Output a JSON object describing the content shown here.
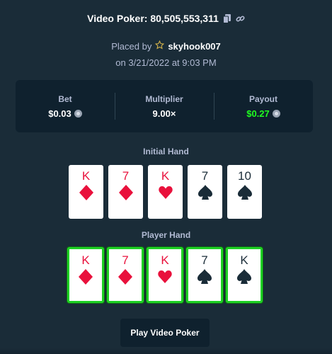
{
  "header": {
    "title": "Video Poker: 80,505,553,311"
  },
  "placed": {
    "prefix": "Placed by",
    "user": "skyhook007",
    "date": "on 3/21/2022 at 9:03 PM"
  },
  "stats": {
    "bet_label": "Bet",
    "bet_value": "$0.03",
    "multiplier_label": "Multiplier",
    "multiplier_value": "9.00×",
    "payout_label": "Payout",
    "payout_value": "$0.27"
  },
  "initial_hand": {
    "label": "Initial Hand",
    "cards": [
      {
        "rank": "K",
        "suit": "diamond",
        "color": "red"
      },
      {
        "rank": "7",
        "suit": "diamond",
        "color": "red"
      },
      {
        "rank": "K",
        "suit": "heart",
        "color": "red"
      },
      {
        "rank": "7",
        "suit": "spade",
        "color": "black"
      },
      {
        "rank": "10",
        "suit": "spade",
        "color": "black"
      }
    ]
  },
  "player_hand": {
    "label": "Player Hand",
    "cards": [
      {
        "rank": "K",
        "suit": "diamond",
        "color": "red"
      },
      {
        "rank": "7",
        "suit": "diamond",
        "color": "red"
      },
      {
        "rank": "K",
        "suit": "heart",
        "color": "red"
      },
      {
        "rank": "7",
        "suit": "spade",
        "color": "black"
      },
      {
        "rank": "K",
        "suit": "spade",
        "color": "black"
      }
    ]
  },
  "actions": {
    "play_label": "Play Video Poker"
  },
  "colors": {
    "background": "#1a2c38",
    "panel": "#0f212e",
    "muted_text": "#b1bad3",
    "payout_green": "#1fff20",
    "held_border": "#1fd025",
    "card_red": "#e9113c"
  }
}
